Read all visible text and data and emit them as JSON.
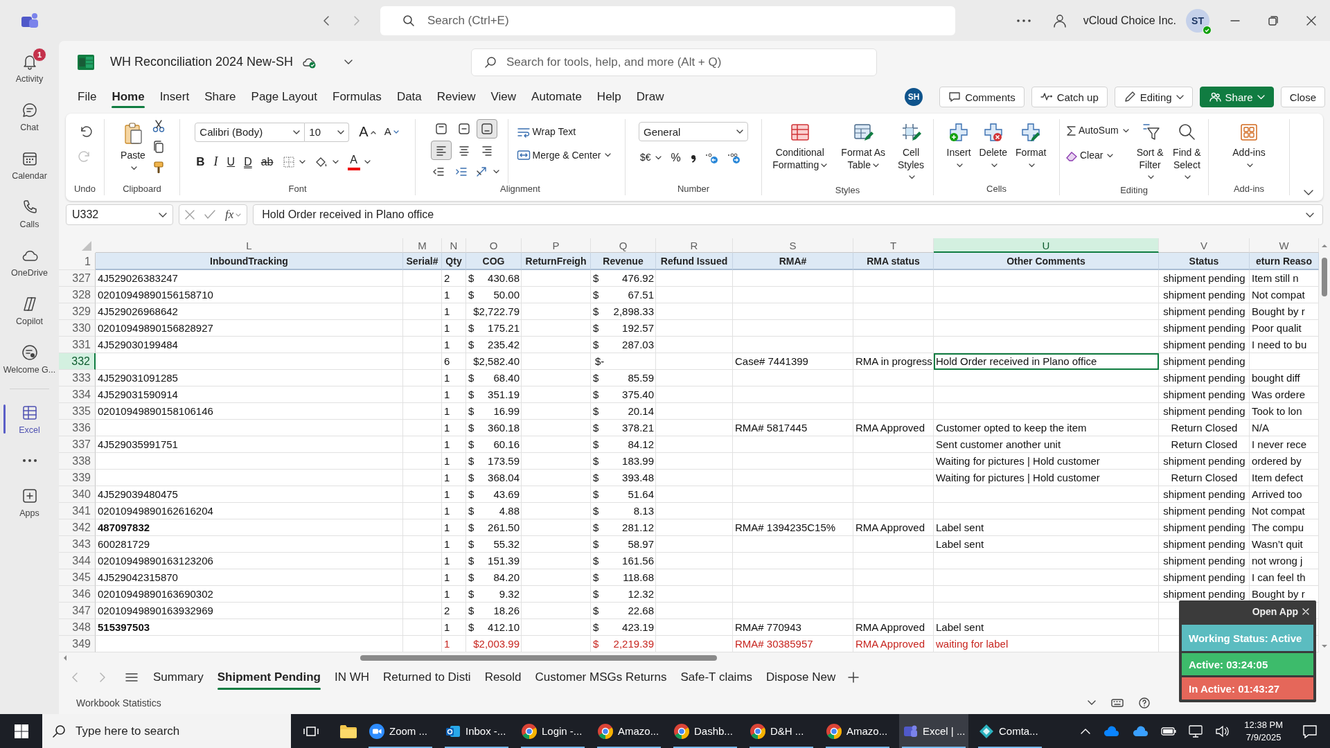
{
  "teams": {
    "search": {
      "placeholder": "Search (Ctrl+E)"
    },
    "org": "vCloud Choice Inc.",
    "avatar": "ST"
  },
  "rail": [
    {
      "kind": "app",
      "label": "Activity",
      "badge": "1",
      "selected": false
    },
    {
      "kind": "app",
      "label": "Chat",
      "selected": false
    },
    {
      "kind": "app",
      "label": "Calendar",
      "selected": false
    },
    {
      "kind": "app",
      "label": "Calls",
      "selected": false
    },
    {
      "kind": "app",
      "label": "OneDrive",
      "selected": false
    },
    {
      "kind": "app",
      "label": "Copilot",
      "selected": false
    },
    {
      "kind": "app",
      "label": "Welcome G...",
      "selected": false
    },
    {
      "kind": "app",
      "label": "Excel",
      "selected": true
    },
    {
      "kind": "more",
      "selected": false
    },
    {
      "kind": "app",
      "label": "Apps",
      "selected": false
    }
  ],
  "workbook": {
    "title": "WH Reconciliation 2024 New-SH",
    "search": {
      "placeholder": "Search for tools, help, and more (Alt + Q)"
    }
  },
  "menu_tabs": [
    {
      "label": "File",
      "selected": false
    },
    {
      "label": "Home",
      "selected": true
    },
    {
      "label": "Insert",
      "selected": false
    },
    {
      "label": "Share",
      "selected": false
    },
    {
      "label": "Page Layout",
      "selected": false
    },
    {
      "label": "Formulas",
      "selected": false
    },
    {
      "label": "Data",
      "selected": false
    },
    {
      "label": "Review",
      "selected": false
    },
    {
      "label": "View",
      "selected": false
    },
    {
      "label": "Automate",
      "selected": false
    },
    {
      "label": "Help",
      "selected": false
    },
    {
      "label": "Draw",
      "selected": false
    }
  ],
  "collaborator": "SH",
  "actions": [
    {
      "label": "Comments",
      "kind": "plain"
    },
    {
      "label": "Catch up",
      "kind": "plain"
    },
    {
      "label": "Editing",
      "kind": "dropdown"
    },
    {
      "label": "Share",
      "kind": "primary"
    },
    {
      "label": "Close",
      "kind": "plain"
    }
  ],
  "ribbon": {
    "undo": {
      "label": "Undo"
    },
    "clipboard": {
      "label": "Clipboard",
      "paste": "Paste"
    },
    "font": {
      "label": "Font",
      "face": "Calibri (Body)",
      "size": "10",
      "grow": "A",
      "shrink": "A",
      "styles": [
        "B",
        "I",
        "U",
        "D",
        "ab"
      ],
      "color_glyph": "A"
    },
    "alignment": {
      "label": "Alignment",
      "buttons": [
        {
          "selected": false
        },
        {
          "selected": false
        },
        {
          "selected": true
        },
        {
          "selected": true
        },
        {
          "selected": false
        },
        {
          "selected": false
        },
        {
          "selected": false
        },
        {
          "selected": false
        }
      ],
      "wrap": "Wrap Text",
      "merge": "Merge & Center"
    },
    "number": {
      "label": "Number",
      "format": "General",
      "currency": "$€",
      "percent": "%"
    },
    "styles": {
      "label": "Styles",
      "buttons": [
        "Conditional Formatting",
        "Format As Table",
        "Cell Styles"
      ]
    },
    "cells": {
      "label": "Cells",
      "buttons": [
        "Insert",
        "Delete",
        "Format"
      ]
    },
    "editing": {
      "label": "Editing",
      "autosum": "AutoSum",
      "clear": "Clear",
      "sort": "Sort & Filter",
      "find": "Find & Select"
    },
    "addins": {
      "label": "Add-ins",
      "button": "Add-ins"
    }
  },
  "formula_bar": {
    "name_box": "U332",
    "fx": "fx",
    "content": "Hold Order received in Plano office"
  },
  "sheet": {
    "header_row": "1",
    "columns": [
      {
        "letter": "L",
        "header": "InboundTracking",
        "selected": false
      },
      {
        "letter": "M",
        "header": "Serial#",
        "selected": false
      },
      {
        "letter": "N",
        "header": "Qty",
        "selected": false
      },
      {
        "letter": "O",
        "header": "COG",
        "selected": false
      },
      {
        "letter": "P",
        "header": "ReturnFreigh",
        "selected": false
      },
      {
        "letter": "Q",
        "header": "Revenue",
        "selected": false
      },
      {
        "letter": "R",
        "header": "Refund Issued",
        "selected": false
      },
      {
        "letter": "S",
        "header": "RMA#",
        "selected": false
      },
      {
        "letter": "T",
        "header": "RMA status",
        "selected": false
      },
      {
        "letter": "U",
        "header": "Other Comments",
        "selected": true
      },
      {
        "letter": "V",
        "header": "Status",
        "selected": false
      },
      {
        "letter": "W",
        "header": "eturn Reaso",
        "selected": false
      }
    ],
    "rows": [
      {
        "number": "327",
        "selected": false,
        "flagged": false,
        "cells": {
          "L": "4J529026383247",
          "N": "2",
          "O": {
            "symbol": "$",
            "amount": "430.68"
          },
          "Q": {
            "symbol": "$",
            "amount": "476.92"
          },
          "V": "shipment pending",
          "W": "Item still n"
        }
      },
      {
        "number": "328",
        "selected": false,
        "flagged": false,
        "cells": {
          "L": "02010949890156158710",
          "N": "1",
          "O": {
            "symbol": "$",
            "amount": "50.00"
          },
          "Q": {
            "symbol": "$",
            "amount": "67.51"
          },
          "V": "shipment pending",
          "W": "Not compat"
        }
      },
      {
        "number": "329",
        "selected": false,
        "flagged": false,
        "cells": {
          "L": "4J529026968642",
          "N": "1",
          "O": "$2,722.79",
          "Q": {
            "symbol": "$",
            "amount": "2,898.33"
          },
          "V": "shipment pending",
          "W": "Bought by r"
        }
      },
      {
        "number": "330",
        "selected": false,
        "flagged": false,
        "cells": {
          "L": "02010949890156828927",
          "N": "1",
          "O": {
            "symbol": "$",
            "amount": "175.21"
          },
          "Q": {
            "symbol": "$",
            "amount": "192.57"
          },
          "V": "shipment pending",
          "W": "Poor qualit"
        }
      },
      {
        "number": "331",
        "selected": false,
        "flagged": false,
        "cells": {
          "L": "4J529030199484",
          "N": "1",
          "O": {
            "symbol": "$",
            "amount": "235.42"
          },
          "Q": {
            "symbol": "$",
            "amount": "287.03"
          },
          "V": "shipment pending",
          "W": "I need to bu"
        }
      },
      {
        "number": "332",
        "selected": true,
        "flagged": false,
        "cells": {
          "N": "6",
          "O": "$2,582.40",
          "Q": {
            "symbol": "$-"
          },
          "S": "Case# 7441399",
          "T": "RMA in progress",
          "U": "Hold Order received in Plano office",
          "V": "shipment pending"
        }
      },
      {
        "number": "333",
        "selected": false,
        "flagged": false,
        "cells": {
          "L": "4J529031091285",
          "N": "1",
          "O": {
            "symbol": "$",
            "amount": "68.40"
          },
          "Q": {
            "symbol": "$",
            "amount": "85.59"
          },
          "V": "shipment pending",
          "W": "bought diff"
        }
      },
      {
        "number": "334",
        "selected": false,
        "flagged": false,
        "cells": {
          "L": "4J529031590914",
          "N": "1",
          "O": {
            "symbol": "$",
            "amount": "351.19"
          },
          "Q": {
            "symbol": "$",
            "amount": "375.40"
          },
          "V": "shipment pending",
          "W": "Was ordere"
        }
      },
      {
        "number": "335",
        "selected": false,
        "flagged": false,
        "cells": {
          "L": "02010949890158106146",
          "N": "1",
          "O": {
            "symbol": "$",
            "amount": "16.99"
          },
          "Q": {
            "symbol": "$",
            "amount": "20.14"
          },
          "V": "shipment pending",
          "W": "Took to lon"
        }
      },
      {
        "number": "336",
        "selected": false,
        "flagged": false,
        "cells": {
          "N": "1",
          "O": {
            "symbol": "$",
            "amount": "360.18"
          },
          "Q": {
            "symbol": "$",
            "amount": "378.21"
          },
          "S": "RMA# 5817445",
          "T": "RMA Approved",
          "U": "Customer opted to keep the item",
          "V": "Return Closed",
          "W": "N/A"
        }
      },
      {
        "number": "337",
        "selected": false,
        "flagged": false,
        "cells": {
          "L": "4J529035991751",
          "N": "1",
          "O": {
            "symbol": "$",
            "amount": "60.16"
          },
          "Q": {
            "symbol": "$",
            "amount": "84.12"
          },
          "U": "Sent customer another unit",
          "V": "Return Closed",
          "W": "I never rece"
        }
      },
      {
        "number": "338",
        "selected": false,
        "flagged": false,
        "cells": {
          "N": "1",
          "O": {
            "symbol": "$",
            "amount": "173.59"
          },
          "Q": {
            "symbol": "$",
            "amount": "183.99"
          },
          "U": "Waiting for pictures | Hold customer",
          "V": "shipment pending",
          "W": "ordered by"
        }
      },
      {
        "number": "339",
        "selected": false,
        "flagged": false,
        "cells": {
          "N": "1",
          "O": {
            "symbol": "$",
            "amount": "368.04"
          },
          "Q": {
            "symbol": "$",
            "amount": "393.48"
          },
          "U": "Waiting for pictures | Hold customer",
          "V": "Return Closed",
          "W": "Item defect"
        }
      },
      {
        "number": "340",
        "selected": false,
        "flagged": false,
        "cells": {
          "L": "4J529039480475",
          "N": "1",
          "O": {
            "symbol": "$",
            "amount": "43.69"
          },
          "Q": {
            "symbol": "$",
            "amount": "51.64"
          },
          "V": "shipment pending",
          "W": "Arrived too"
        }
      },
      {
        "number": "341",
        "selected": false,
        "flagged": false,
        "cells": {
          "L": "02010949890162616204",
          "N": "1",
          "O": {
            "symbol": "$",
            "amount": "4.88"
          },
          "Q": {
            "symbol": "$",
            "amount": "8.13"
          },
          "V": "shipment pending",
          "W": "Not compat"
        }
      },
      {
        "number": "342",
        "selected": false,
        "flagged": false,
        "cells": {
          "L": {
            "text": "487097832",
            "bold": true
          },
          "N": "1",
          "O": {
            "symbol": "$",
            "amount": "261.50"
          },
          "Q": {
            "symbol": "$",
            "amount": "281.12"
          },
          "S": "RMA# 1394235C15%",
          "T": "RMA Approved",
          "U": "Label sent",
          "V": "shipment pending",
          "W": "The compu"
        }
      },
      {
        "number": "343",
        "selected": false,
        "flagged": false,
        "cells": {
          "L": "600281729",
          "N": "1",
          "O": {
            "symbol": "$",
            "amount": "55.32"
          },
          "Q": {
            "symbol": "$",
            "amount": "58.97"
          },
          "U": "Label sent",
          "V": "shipment pending",
          "W": "Wasn’t quit"
        }
      },
      {
        "number": "344",
        "selected": false,
        "flagged": false,
        "cells": {
          "L": "02010949890163123206",
          "N": "1",
          "O": {
            "symbol": "$",
            "amount": "151.39"
          },
          "Q": {
            "symbol": "$",
            "amount": "161.56"
          },
          "V": "shipment pending",
          "W": "not wrong j"
        }
      },
      {
        "number": "345",
        "selected": false,
        "flagged": false,
        "cells": {
          "L": "4J529042315870",
          "N": "1",
          "O": {
            "symbol": "$",
            "amount": "84.20"
          },
          "Q": {
            "symbol": "$",
            "amount": "118.68"
          },
          "V": "shipment pending",
          "W": "I can feel th"
        }
      },
      {
        "number": "346",
        "selected": false,
        "flagged": false,
        "cells": {
          "L": "02010949890163690302",
          "N": "1",
          "O": {
            "symbol": "$",
            "amount": "9.32"
          },
          "Q": {
            "symbol": "$",
            "amount": "12.32"
          },
          "V": "shipment pending",
          "W": "Bought by r"
        }
      },
      {
        "number": "347",
        "selected": false,
        "flagged": false,
        "cells": {
          "L": "02010949890163932969",
          "N": "2",
          "O": {
            "symbol": "$",
            "amount": "18.26"
          },
          "Q": {
            "symbol": "$",
            "amount": "22.68"
          }
        }
      },
      {
        "number": "348",
        "selected": false,
        "flagged": false,
        "cells": {
          "L": {
            "text": "515397503",
            "bold": true
          },
          "N": "1",
          "O": {
            "symbol": "$",
            "amount": "412.10"
          },
          "Q": {
            "symbol": "$",
            "amount": "423.19"
          },
          "S": "RMA# 770943",
          "T": "RMA Approved",
          "U": "Label sent"
        }
      },
      {
        "number": "349",
        "selected": false,
        "flagged": true,
        "cells": {
          "N": "1",
          "O": "$2,003.99",
          "Q": {
            "symbol": "$",
            "amount": "2,219.39"
          },
          "S": "RMA# 30385957",
          "T": "RMA Approved",
          "U": "waiting for label"
        }
      }
    ]
  },
  "sheet_tabs": [
    {
      "label": "Summary",
      "selected": false
    },
    {
      "label": "Shipment Pending",
      "selected": true
    },
    {
      "label": "IN WH",
      "selected": false
    },
    {
      "label": "Returned to Disti",
      "selected": false
    },
    {
      "label": "Resold",
      "selected": false
    },
    {
      "label": "Customer MSGs Returns",
      "selected": false
    },
    {
      "label": "Safe-T claims",
      "selected": false
    },
    {
      "label": "Dispose New",
      "selected": false
    }
  ],
  "status_bar": {
    "text": "Workbook Statistics"
  },
  "taskbar": {
    "search": {
      "placeholder": "Type here to search"
    },
    "apps": [
      {
        "label": "Zoom ...",
        "selected": false
      },
      {
        "label": "Inbox -...",
        "selected": false
      },
      {
        "label": "Login -...",
        "selected": false
      },
      {
        "label": "Amazo...",
        "selected": false
      },
      {
        "label": "Dashb...",
        "selected": false
      },
      {
        "label": "D&H ...",
        "selected": false
      },
      {
        "label": "Amazo...",
        "selected": false
      },
      {
        "label": "Excel | ...",
        "selected": true
      },
      {
        "label": "Comta...",
        "selected": false
      }
    ],
    "time": "12:38 PM",
    "date": "7/9/2025"
  },
  "timer_widget": {
    "open_app": "Open App",
    "status": "Working Status: Active",
    "active": "Active: 03:24:05",
    "inactive": "In Active: 01:43:27"
  }
}
